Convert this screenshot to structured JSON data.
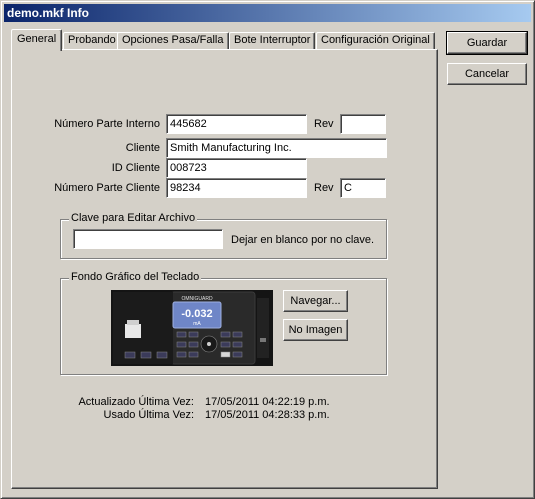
{
  "window": {
    "title": "demo.mkf Info"
  },
  "tabs": [
    {
      "label": "General"
    },
    {
      "label": "Probando"
    },
    {
      "label": "Opciones Pasa/Falla"
    },
    {
      "label": "Bote Interruptor"
    },
    {
      "label": "Configuración Original"
    }
  ],
  "actions": {
    "save_label": "Guardar",
    "cancel_label": "Cancelar"
  },
  "form": {
    "part_internal_label": "Número Parte Interno",
    "part_internal_value": "445682",
    "rev_label": "Rev",
    "rev_internal_value": "",
    "client_label": "Cliente",
    "client_value": "Smith Manufacturing Inc.",
    "client_id_label": "ID Cliente",
    "client_id_value": "008723",
    "part_client_label": "Número Parte Cliente",
    "part_client_value": "98234",
    "rev_client_value": "C"
  },
  "password_group": {
    "title": "Clave para Editar Archivo",
    "value": "",
    "hint": "Dejar en blanco por no clave."
  },
  "keypad_group": {
    "title": "Fondo Gráfico del Teclado",
    "browse_label": "Navegar...",
    "no_image_label": "No Imagen",
    "device_brand": "OMNIGUARD",
    "device_reading": "-0.032",
    "device_unit": "mA"
  },
  "timestamps": {
    "updated_label": "Actualizado Última Vez:",
    "updated_value": "17/05/2011 04:22:19 p.m.",
    "used_label": "Usado Última Vez:",
    "used_value": "17/05/2011 04:28:33 p.m."
  },
  "colors": {
    "titlebar_start": "#0a246a",
    "titlebar_end": "#a6caf0",
    "window_face": "#d4d0c8",
    "device_screen": "#6f86c7"
  }
}
